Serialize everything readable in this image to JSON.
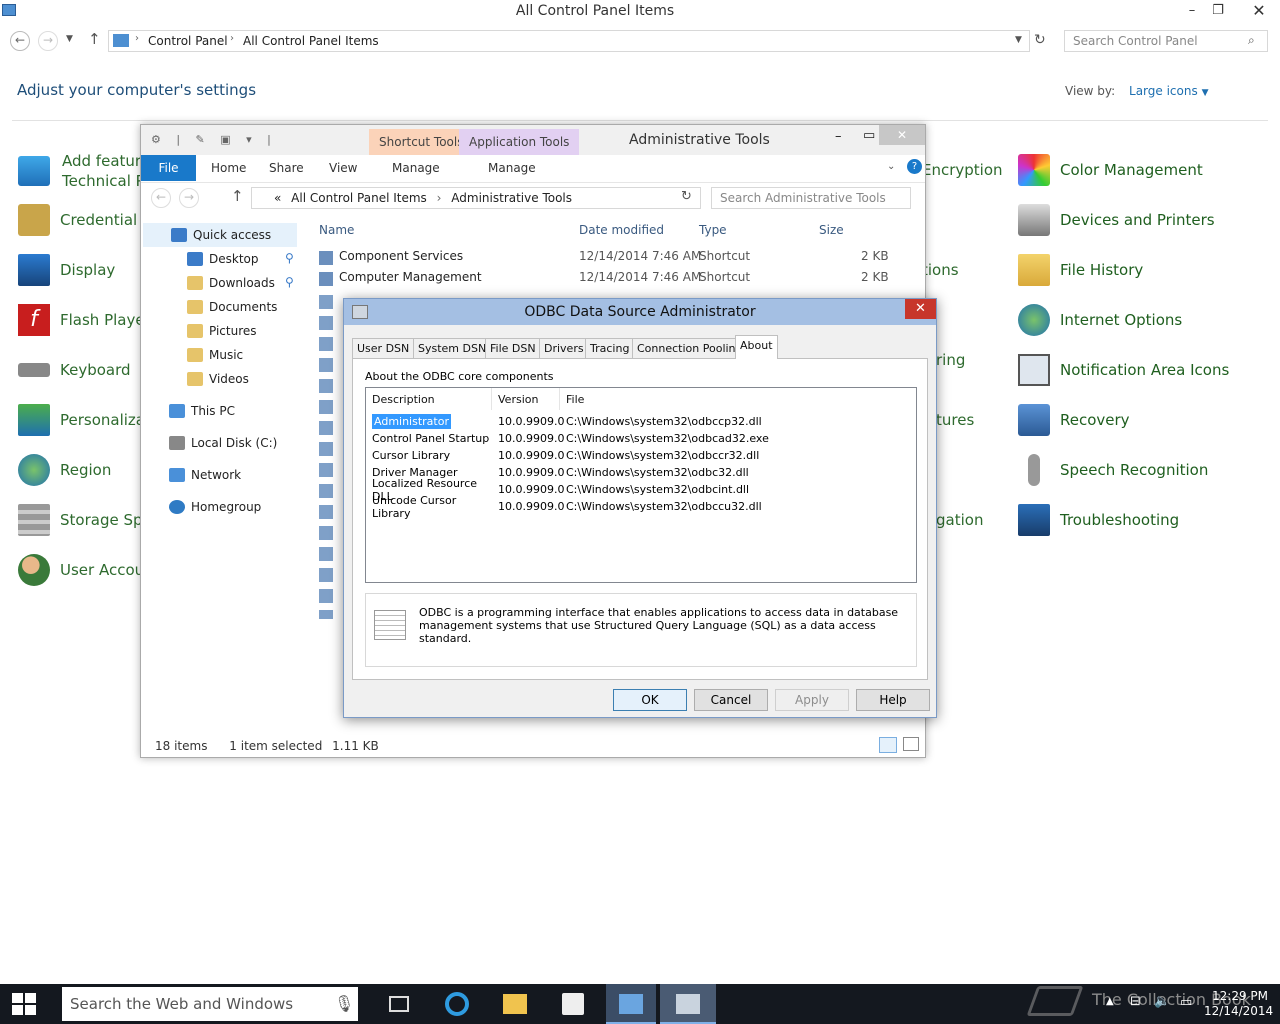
{
  "control_panel": {
    "title": "All Control Panel Items",
    "address": {
      "root": "Control Panel",
      "current": "All Control Panel Items"
    },
    "search_placeholder": "Search Control Panel",
    "heading": "Adjust your computer's settings",
    "view_by_label": "View by:",
    "view_by_value": "Large icons",
    "left_items": [
      "Add features to Windows",
      "Technical Pr",
      "Credential M",
      "Display",
      "Flash Playe",
      "Keyboard",
      "Personaliza",
      "Region",
      "Storage Spa",
      "User Accou"
    ],
    "middle_partial": [
      "Encryption",
      "tions",
      "ring",
      "tures",
      "gation"
    ],
    "right_items": [
      "Color Management",
      "Devices and Printers",
      "File History",
      "Internet Options",
      "Notification Area Icons",
      "Recovery",
      "Speech Recognition",
      "Troubleshooting"
    ]
  },
  "explorer": {
    "title": "Administrative Tools",
    "context_tabs": [
      "Shortcut Tools",
      "Application Tools"
    ],
    "ribbon_tabs": [
      "File",
      "Home",
      "Share",
      "View",
      "Manage",
      "Manage"
    ],
    "address": {
      "prefix": "«",
      "parent": "All Control Panel Items",
      "current": "Administrative Tools"
    },
    "search_placeholder": "Search Administrative Tools",
    "nav": [
      "Quick access",
      "Desktop",
      "Downloads",
      "Documents",
      "Pictures",
      "Music",
      "Videos",
      "This PC",
      "Local Disk (C:)",
      "Network",
      "Homegroup"
    ],
    "columns": [
      "Name",
      "Date modified",
      "Type",
      "Size"
    ],
    "files": [
      {
        "name": "Component Services",
        "date": "12/14/2014 7:46 AM",
        "type": "Shortcut",
        "size": "2 KB"
      },
      {
        "name": "Computer Management",
        "date": "12/14/2014 7:46 AM",
        "type": "Shortcut",
        "size": "2 KB"
      }
    ],
    "status": {
      "count": "18 items",
      "selected": "1 item selected",
      "size": "1.11 KB"
    }
  },
  "odbc": {
    "title": "ODBC Data Source Administrator",
    "tabs": [
      "User DSN",
      "System DSN",
      "File DSN",
      "Drivers",
      "Tracing",
      "Connection Pooling",
      "About"
    ],
    "section_label": "About the ODBC core components",
    "columns": [
      "Description",
      "Version",
      "File"
    ],
    "rows": [
      {
        "desc": "Administrator",
        "ver": "10.0.9909.0",
        "file": "C:\\Windows\\system32\\odbccp32.dll"
      },
      {
        "desc": "Control Panel Startup",
        "ver": "10.0.9909.0",
        "file": "C:\\Windows\\system32\\odbcad32.exe"
      },
      {
        "desc": "Cursor Library",
        "ver": "10.0.9909.0",
        "file": "C:\\Windows\\system32\\odbccr32.dll"
      },
      {
        "desc": "Driver Manager",
        "ver": "10.0.9909.0",
        "file": "C:\\Windows\\system32\\odbc32.dll"
      },
      {
        "desc": "Localized Resource DLL",
        "ver": "10.0.9909.0",
        "file": "C:\\Windows\\system32\\odbcint.dll"
      },
      {
        "desc": "Unicode Cursor Library",
        "ver": "10.0.9909.0",
        "file": "C:\\Windows\\system32\\odbccu32.dll"
      }
    ],
    "info": "ODBC is a programming interface that enables applications to access data in database management systems that use Structured Query Language (SQL) as a data access standard.",
    "buttons": {
      "ok": "OK",
      "cancel": "Cancel",
      "apply": "Apply",
      "help": "Help"
    }
  },
  "taskbar": {
    "search_placeholder": "Search the Web and Windows",
    "time": "12:29 PM",
    "date": "12/14/2014",
    "watermark": "The Collection Book"
  },
  "colors": {
    "accent": "#1979ca",
    "link": "#1f5f1f",
    "dialog_title": "#a4bfe3",
    "close_red": "#c7362b",
    "taskbar": "#14181f"
  }
}
